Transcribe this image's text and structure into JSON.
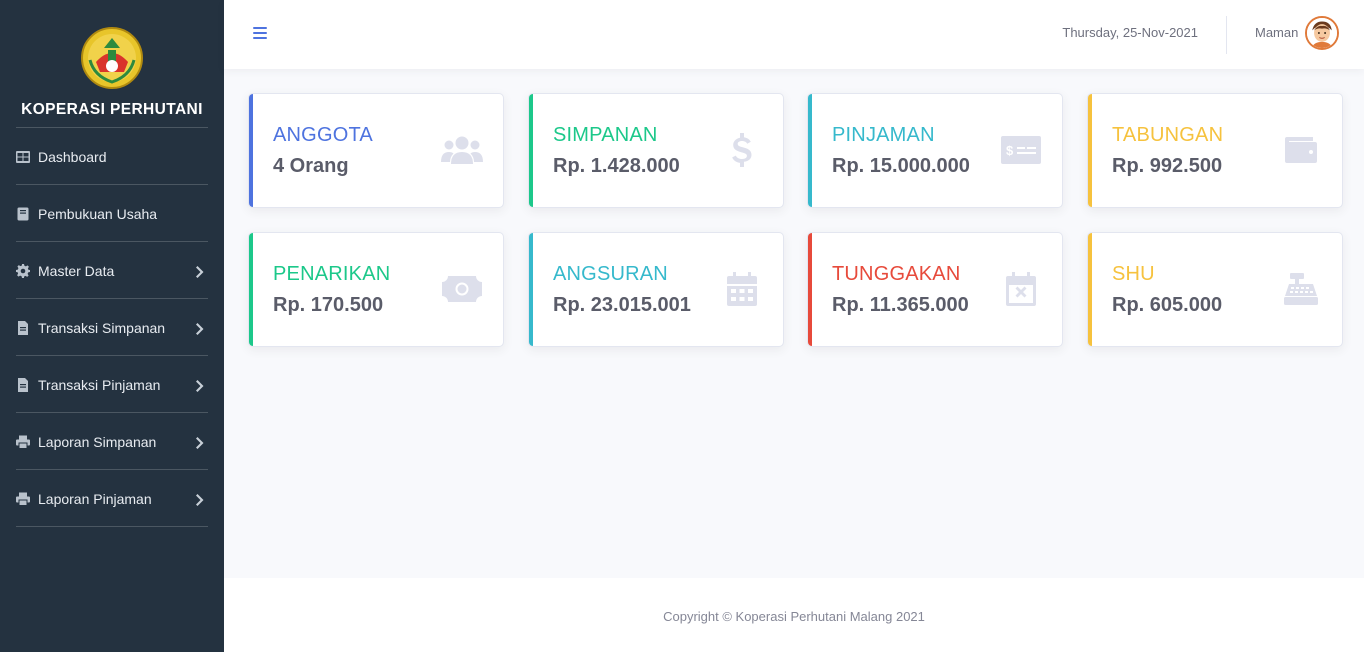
{
  "brand": {
    "name": "KOPERASI PERHUTANI",
    "logo": "koperasi-logo"
  },
  "sidebar": {
    "items": [
      {
        "label": "Dashboard",
        "icon": "dashboard-icon",
        "has_submenu": false
      },
      {
        "label": "Pembukuan Usaha",
        "icon": "book-icon",
        "has_submenu": false
      },
      {
        "label": "Master Data",
        "icon": "gear-icon",
        "has_submenu": true
      },
      {
        "label": "Transaksi Simpanan",
        "icon": "file-icon",
        "has_submenu": true
      },
      {
        "label": "Transaksi Pinjaman",
        "icon": "file-icon",
        "has_submenu": true
      },
      {
        "label": "Laporan Simpanan",
        "icon": "print-icon",
        "has_submenu": true
      },
      {
        "label": "Laporan Pinjaman",
        "icon": "print-icon",
        "has_submenu": true
      }
    ]
  },
  "topbar": {
    "menu_icon": "hamburger-icon",
    "date": "Thursday, 25-Nov-2021",
    "user_name": "Maman",
    "avatar": "user-avatar"
  },
  "cards": [
    {
      "title": "ANGGOTA",
      "value": "4 Orang",
      "color": "#4e73df",
      "icon": "users-icon"
    },
    {
      "title": "SIMPANAN",
      "value": "Rp. 1.428.000",
      "color": "#1cc88a",
      "icon": "dollar-icon"
    },
    {
      "title": "PINJAMAN",
      "value": "Rp. 15.000.000",
      "color": "#36b9cc",
      "icon": "money-check-icon"
    },
    {
      "title": "TABUNGAN",
      "value": "Rp. 992.500",
      "color": "#f6c23e",
      "icon": "wallet-icon"
    },
    {
      "title": "PENARIKAN",
      "value": "Rp. 170.500",
      "color": "#1cc88a",
      "icon": "money-bill-icon"
    },
    {
      "title": "ANGSURAN",
      "value": "Rp. 23.015.001",
      "color": "#36b9cc",
      "icon": "calendar-icon"
    },
    {
      "title": "TUNGGAKAN",
      "value": "Rp. 11.365.000",
      "color": "#e74a3b",
      "icon": "calendar-times-icon"
    },
    {
      "title": "SHU",
      "value": "Rp. 605.000",
      "color": "#f6c23e",
      "icon": "cash-register-icon"
    }
  ],
  "footer": {
    "text": "Copyright © Koperasi Perhutani Malang 2021"
  }
}
